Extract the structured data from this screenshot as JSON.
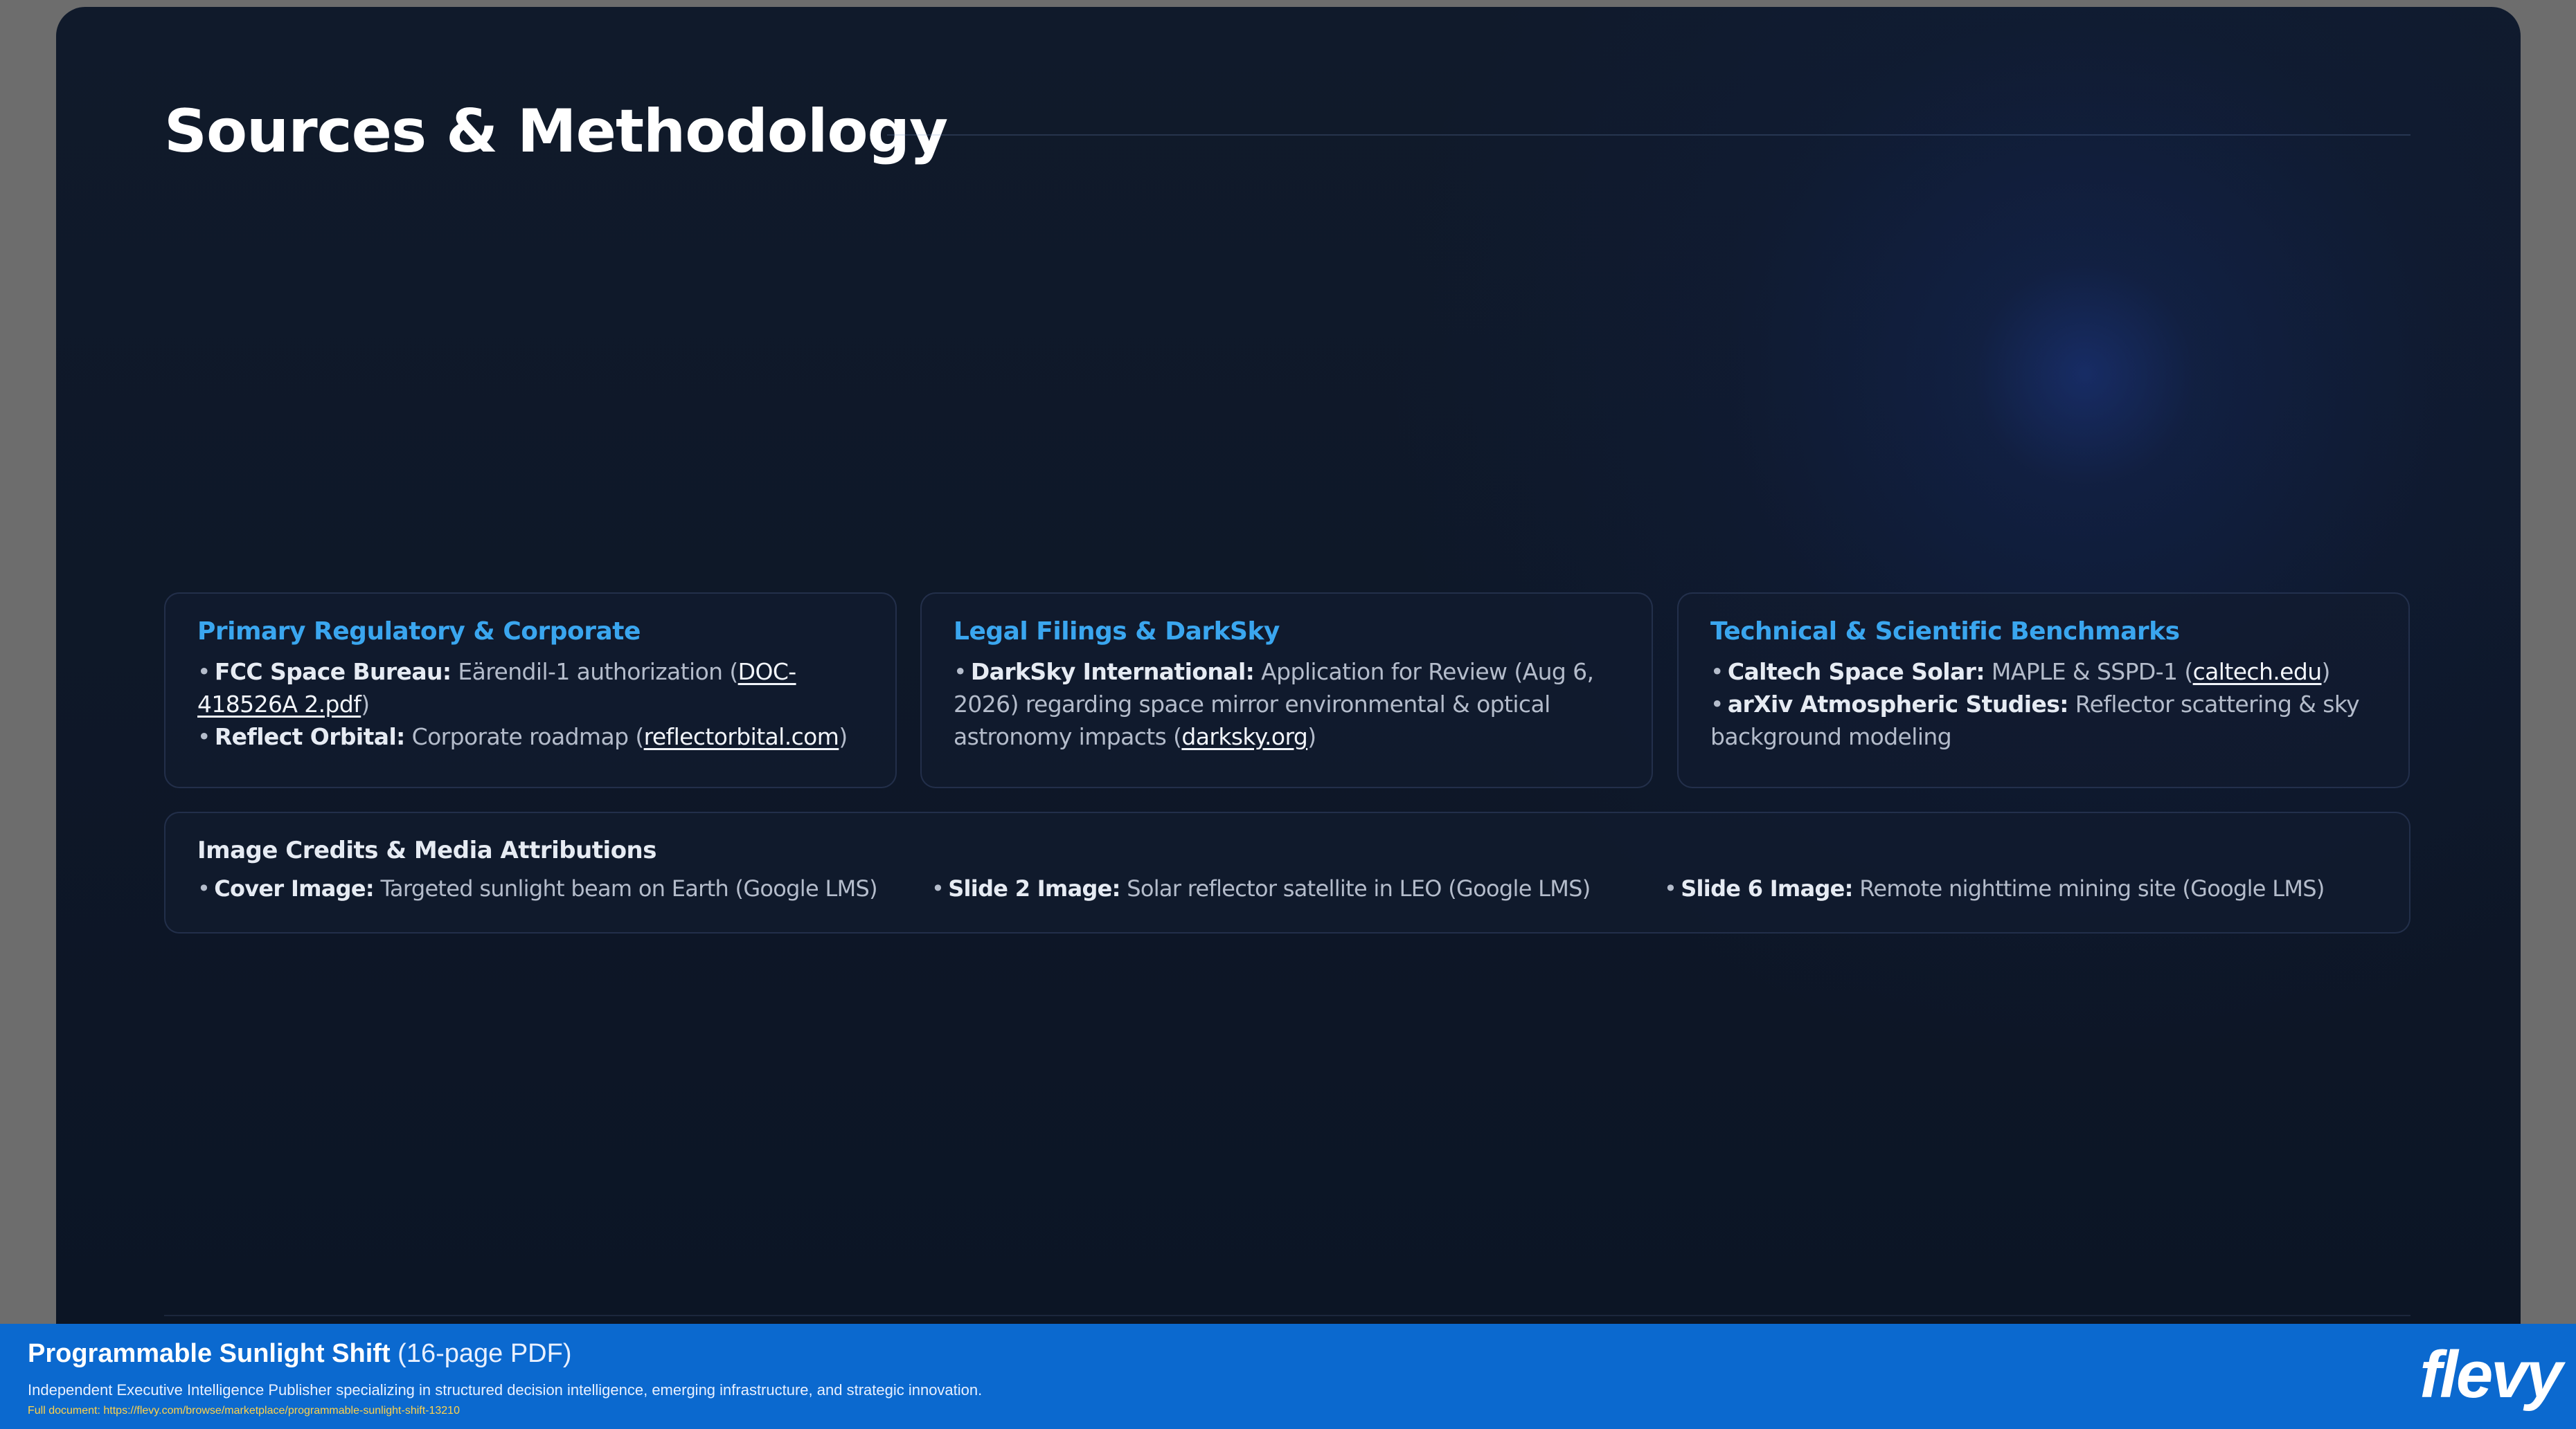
{
  "slide": {
    "title": "Sources & Methodology"
  },
  "cards": [
    {
      "title": "Primary Regulatory & Corporate",
      "items": [
        {
          "label": "FCC Space Bureau:",
          "text": " Eärendil-1 authorization (",
          "link": "DOC-418526A 2.pdf",
          "close": ")"
        },
        {
          "label": "Reflect Orbital:",
          "text": " Corporate roadmap (",
          "link": "reflectorbital.com",
          "close": ")"
        }
      ]
    },
    {
      "title": "Legal Filings & DarkSky",
      "items": [
        {
          "label": "DarkSky International:",
          "text": " Application for Review (Aug 6, 2026) regarding space mirror environmental & optical astronomy impacts (",
          "link": "darksky.org",
          "close": ")"
        }
      ]
    },
    {
      "title": "Technical & Scientific Benchmarks",
      "items": [
        {
          "label": "Caltech Space Solar:",
          "text": " MAPLE & SSPD-1 (",
          "link": "caltech.edu",
          "close": ")"
        },
        {
          "label": "arXiv Atmospheric Studies:",
          "text": " Reflector scattering & sky background modeling",
          "link": "",
          "close": ""
        }
      ]
    }
  ],
  "credits": {
    "title": "Image Credits & Media Attributions",
    "items": [
      {
        "label": "Cover Image:",
        "text": " Targeted sunlight beam on Earth (Google LMS)"
      },
      {
        "label": "Slide 2 Image:",
        "text": " Solar reflector satellite in LEO (Google LMS)"
      },
      {
        "label": "Slide 6 Image:",
        "text": " Remote nighttime mining site (Google LMS)"
      }
    ]
  },
  "bullet": "•",
  "footer": {
    "title": "Programmable Sunlight Shift",
    "pages": " (16-page PDF)",
    "description": "Independent Executive Intelligence Publisher specializing in structured decision intelligence, emerging infrastructure, and strategic innovation.",
    "link_text": "Full document: https://flevy.com/browse/marketplace/programmable-sunlight-shift-13210",
    "logo": "flevy"
  },
  "colors": {
    "accent": "#3aa6ef",
    "footer_bg": "#0b69cf",
    "link_yellow": "#ffd24a"
  }
}
